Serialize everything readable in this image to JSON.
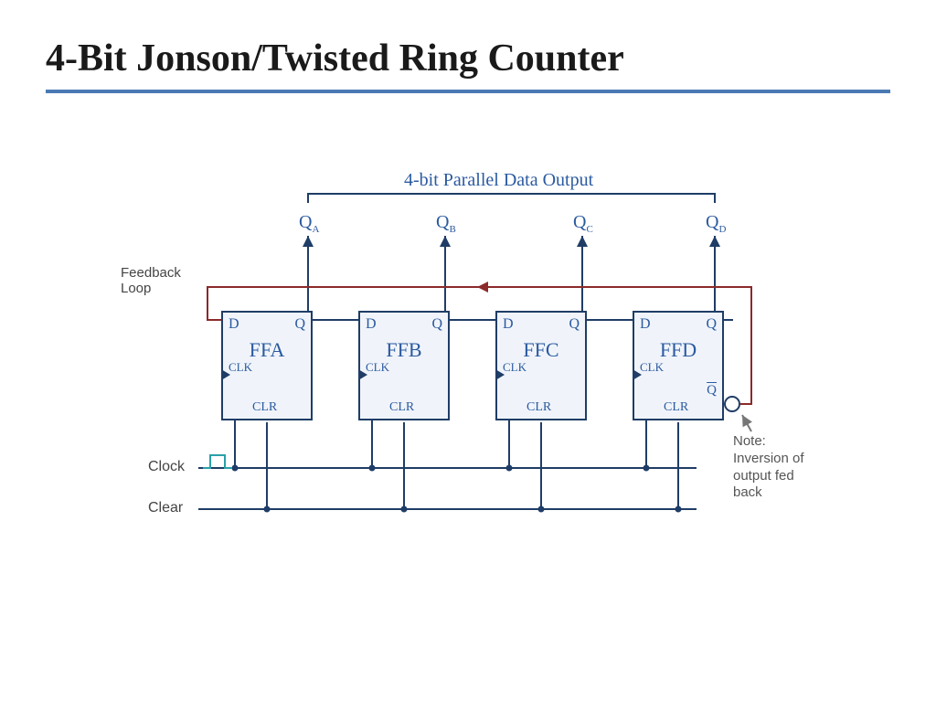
{
  "slide": {
    "title": "4-Bit Jonson/Twisted Ring Counter"
  },
  "diagram": {
    "header": "4-bit Parallel Data Output",
    "feedback_label": "Feedback\nLoop",
    "outputs": [
      "Q_A",
      "Q_B",
      "Q_C",
      "Q_D"
    ],
    "flipflops": [
      {
        "name": "FFA",
        "d": "D",
        "q": "Q",
        "clk": "CLK",
        "clr": "CLR"
      },
      {
        "name": "FFB",
        "d": "D",
        "q": "Q",
        "clk": "CLK",
        "clr": "CLR"
      },
      {
        "name": "FFC",
        "d": "D",
        "q": "Q",
        "clk": "CLK",
        "clr": "CLR"
      },
      {
        "name": "FFD",
        "d": "D",
        "q": "Q",
        "clk": "CLK",
        "clr": "CLR",
        "qbar": "Q"
      }
    ],
    "rails": {
      "clock": "Clock",
      "clear": "Clear"
    },
    "note": "Note:\nInversion of\noutput fed\nback"
  },
  "colors": {
    "rule": "#4a7ab3",
    "wire": "#1f3d66",
    "feedback": "#8b2a2a",
    "ff_fill": "#f0f4fa",
    "label_blue": "#2b5aa0"
  }
}
